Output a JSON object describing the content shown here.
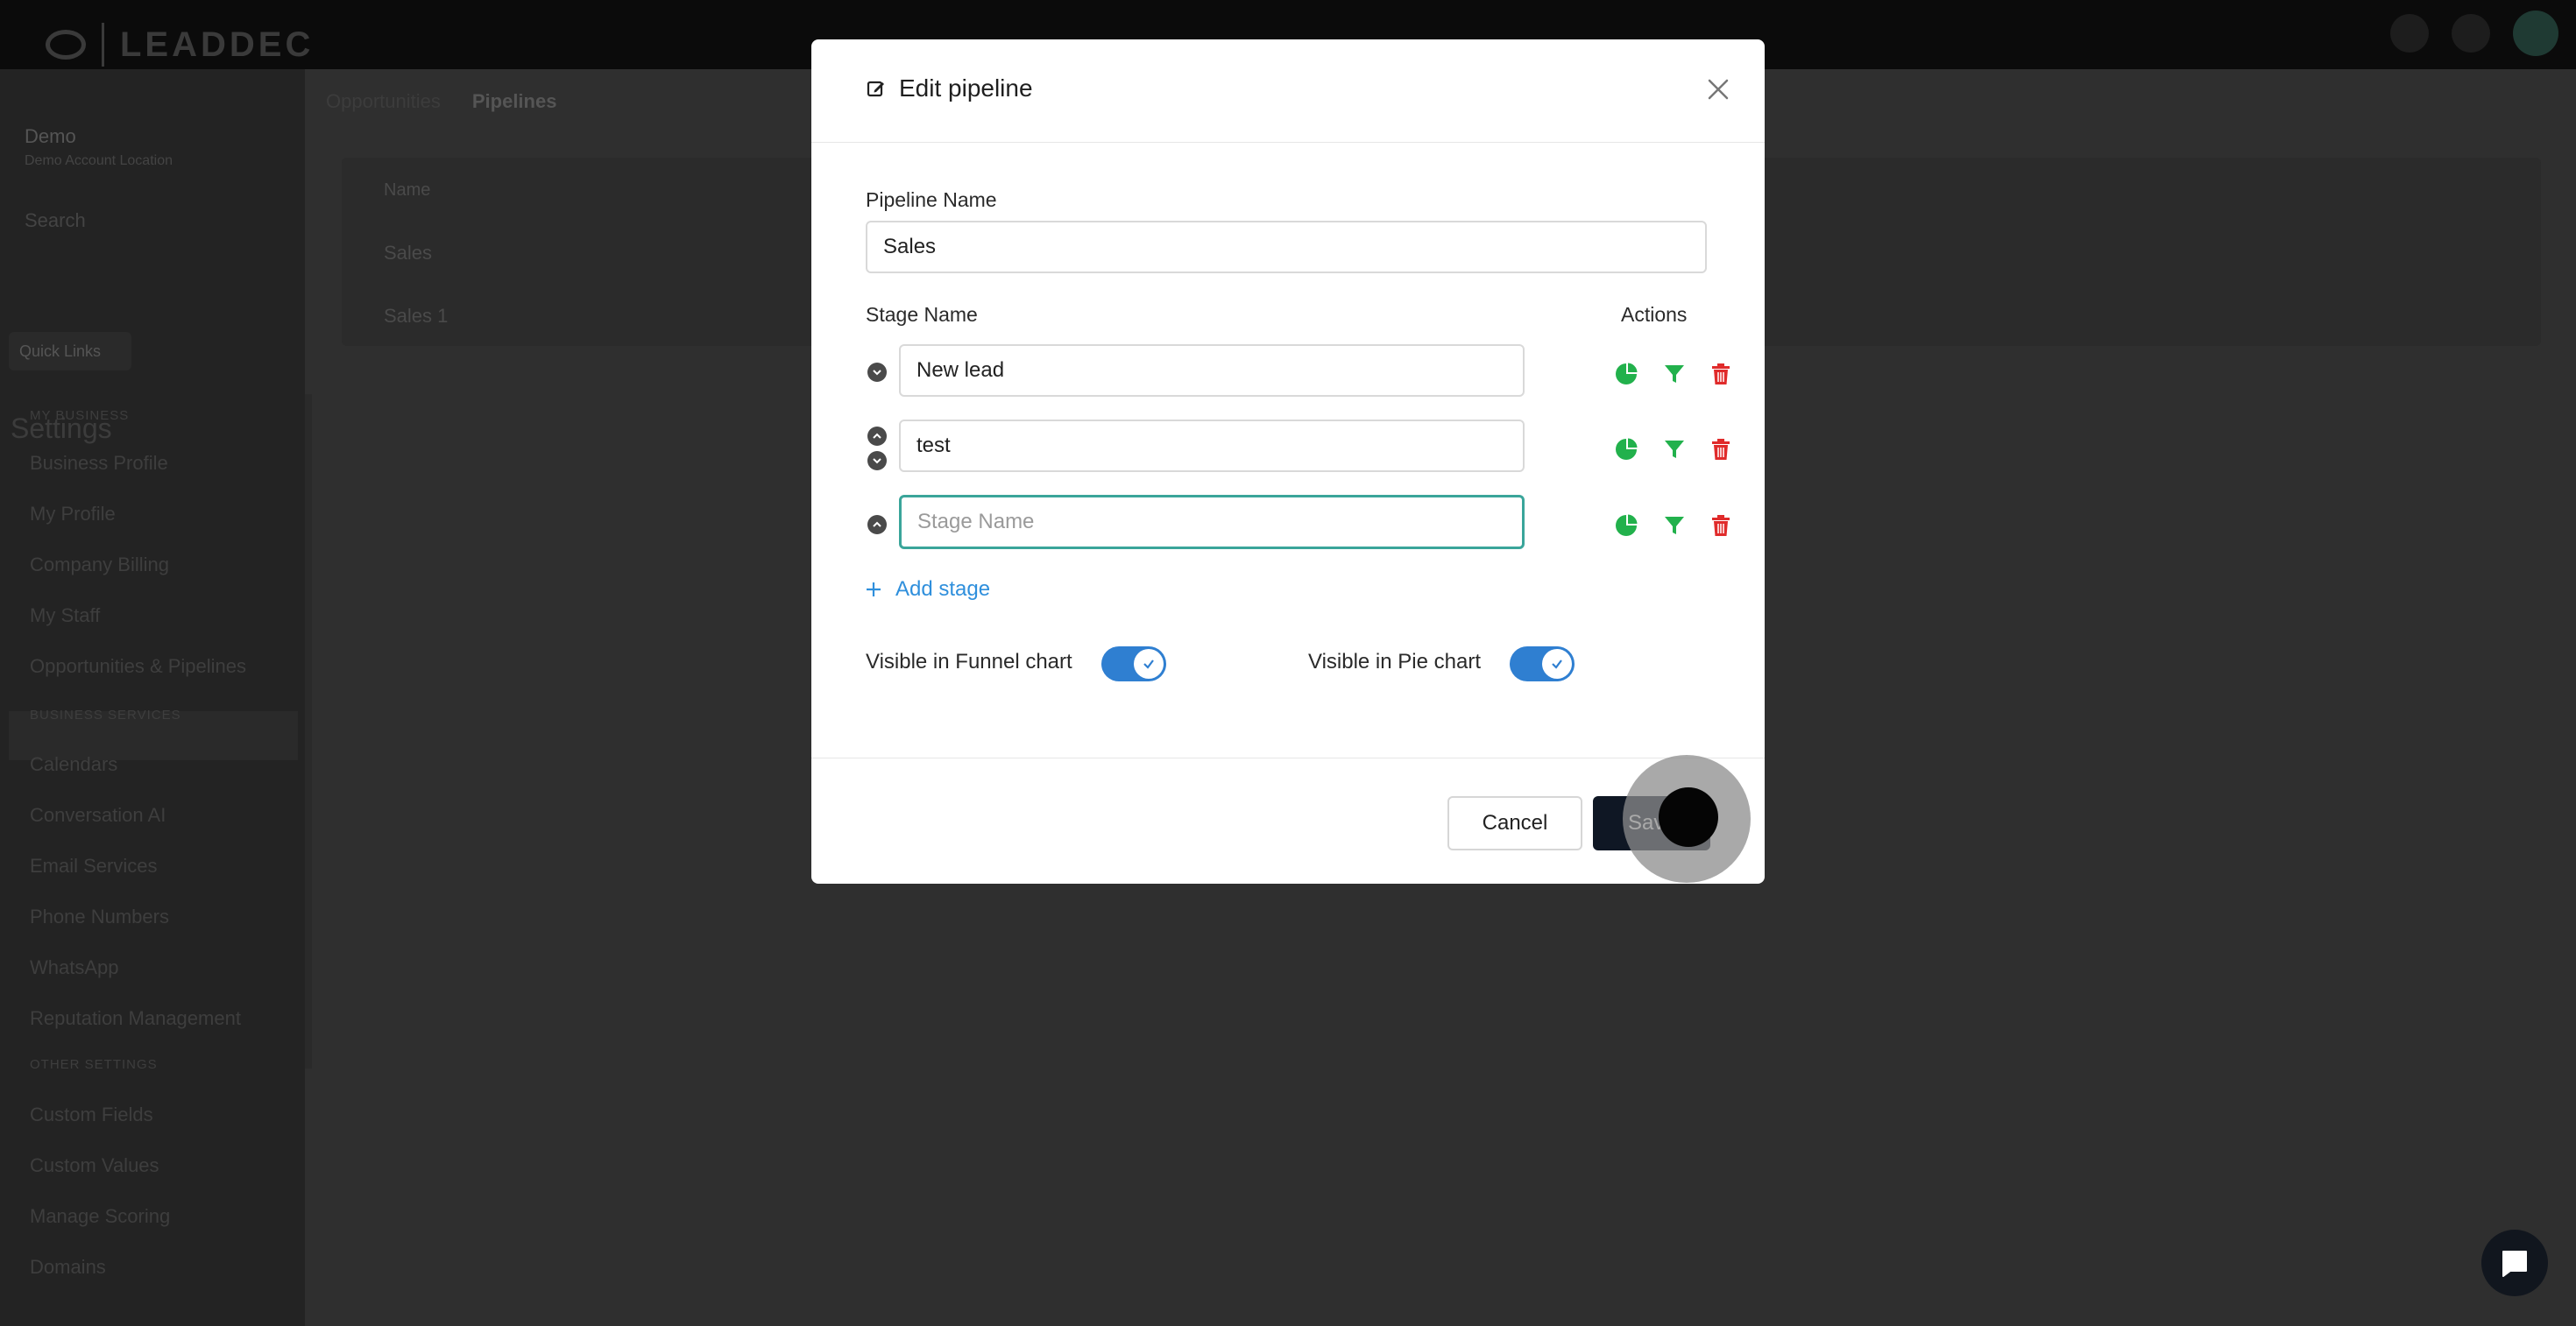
{
  "app": {
    "logo_text": "LEADDEC"
  },
  "sidebar": {
    "account_name": "Demo",
    "account_sub": "Demo Account Location",
    "search_placeholder": "Search",
    "quick_button": "Quick Links",
    "settings_title": "Settings",
    "sections": [
      {
        "heading": "MY BUSINESS",
        "items": [
          "Business Profile",
          "My Profile",
          "Company Billing",
          "My Staff",
          "Opportunities & Pipelines"
        ]
      },
      {
        "heading": "BUSINESS SERVICES",
        "items": [
          "Calendars",
          "Conversation AI",
          "Email Services",
          "Phone Numbers",
          "WhatsApp",
          "Reputation Management"
        ]
      },
      {
        "heading": "OTHER SETTINGS",
        "items": [
          "Custom Fields",
          "Custom Values",
          "Manage Scoring",
          "Domains"
        ]
      }
    ]
  },
  "main": {
    "tabs": [
      "Opportunities",
      "Pipelines"
    ],
    "table_header": "Name",
    "rows": [
      "Sales",
      "Sales 1"
    ]
  },
  "modal": {
    "title": "Edit pipeline",
    "pipeline_name_label": "Pipeline Name",
    "pipeline_name_value": "Sales",
    "stage_name_header": "Stage Name",
    "actions_header": "Actions",
    "stages": [
      {
        "value": "New lead",
        "placeholder": "Stage Name"
      },
      {
        "value": "test",
        "placeholder": "Stage Name"
      },
      {
        "value": "",
        "placeholder": "Stage Name"
      }
    ],
    "add_stage_label": "Add stage",
    "funnel_toggle_label": "Visible in Funnel chart",
    "funnel_toggle_on": true,
    "pie_toggle_label": "Visible in Pie chart",
    "pie_toggle_on": true,
    "cancel_label": "Cancel",
    "save_label": "Save"
  },
  "colors": {
    "accent_blue": "#2f7fd1",
    "link_blue": "#2f8fdc",
    "icon_green": "#22b14c",
    "delete_red": "#e02b2b",
    "focus_teal": "#3aa59a",
    "save_dark": "#0f1724"
  }
}
